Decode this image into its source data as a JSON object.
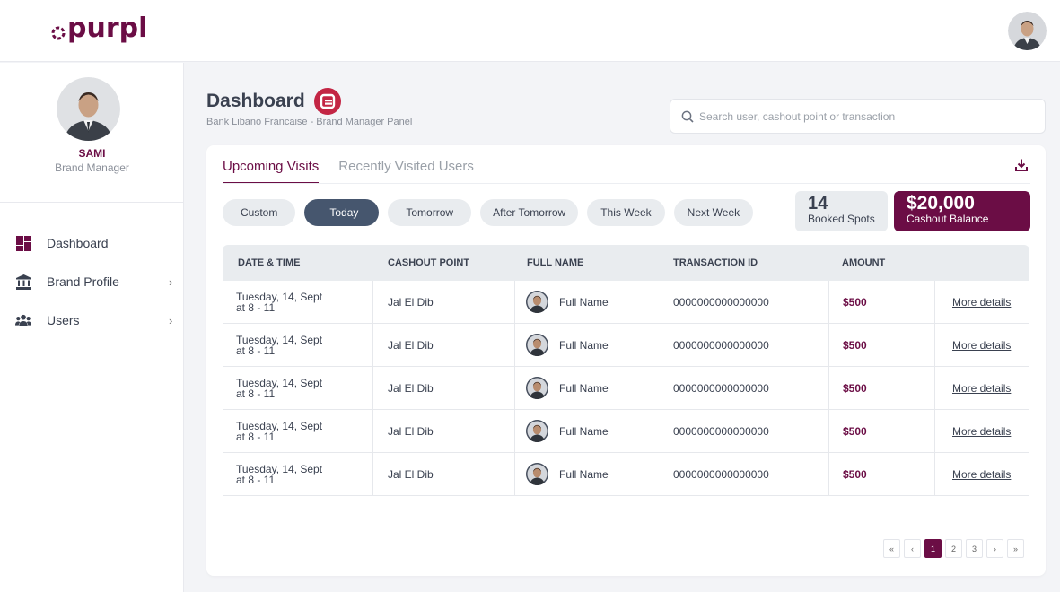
{
  "app": {
    "logo_text": "purpl"
  },
  "colors": {
    "brand": "#6b0d45",
    "active_chip": "#46566e",
    "badge": "#c32544"
  },
  "sidebar": {
    "user": {
      "name": "SAMI",
      "role": "Brand Manager"
    },
    "items": [
      {
        "label": "Dashboard",
        "icon": "dashboard-icon",
        "active": true
      },
      {
        "label": "Brand Profile",
        "icon": "bank-icon",
        "chevron": "›"
      },
      {
        "label": "Users",
        "icon": "users-icon",
        "chevron": "›"
      }
    ]
  },
  "header": {
    "title": "Dashboard",
    "subtitle": "Bank Libano Francaise - Brand Manager Panel",
    "search_placeholder": "Search user, cashout point or transaction"
  },
  "tabs": [
    {
      "label": "Upcoming Visits",
      "active": true
    },
    {
      "label": "Recently Visited Users",
      "active": false
    }
  ],
  "filters": [
    {
      "label": "Custom",
      "active": false
    },
    {
      "label": "Today",
      "active": true
    },
    {
      "label": "Tomorrow",
      "active": false
    },
    {
      "label": "After Tomorrow",
      "active": false
    },
    {
      "label": "This Week",
      "active": false
    },
    {
      "label": "Next Week",
      "active": false
    }
  ],
  "stats": {
    "booked": {
      "value": "14",
      "label": "Booked Spots"
    },
    "cashout": {
      "value": "$20,000",
      "label": "Cashout Balance"
    }
  },
  "table": {
    "columns": [
      "DATE & TIME",
      "CASHOUT POINT",
      "FULL NAME",
      "TRANSACTION ID",
      "AMOUNT"
    ],
    "rows": [
      {
        "date": "Tuesday, 14, Sept",
        "time": "at 8 - 11",
        "point": "Jal El Dib",
        "name": "Full Name",
        "txn": "0000000000000000",
        "amount": "$500",
        "link": "More details"
      },
      {
        "date": "Tuesday, 14, Sept",
        "time": "at 8 - 11",
        "point": "Jal El Dib",
        "name": "Full Name",
        "txn": "0000000000000000",
        "amount": "$500",
        "link": "More details"
      },
      {
        "date": "Tuesday, 14, Sept",
        "time": "at 8 - 11",
        "point": "Jal El Dib",
        "name": "Full Name",
        "txn": "0000000000000000",
        "amount": "$500",
        "link": "More details"
      },
      {
        "date": "Tuesday, 14, Sept",
        "time": "at 8 - 11",
        "point": "Jal El Dib",
        "name": "Full Name",
        "txn": "0000000000000000",
        "amount": "$500",
        "link": "More details"
      },
      {
        "date": "Tuesday, 14, Sept",
        "time": "at 8 - 11",
        "point": "Jal El Dib",
        "name": "Full Name",
        "txn": "0000000000000000",
        "amount": "$500",
        "link": "More details"
      }
    ]
  },
  "pagination": {
    "first": "«",
    "prev": "‹",
    "pages": [
      "1",
      "2",
      "3"
    ],
    "current": "1",
    "next": "›",
    "last": "»"
  }
}
